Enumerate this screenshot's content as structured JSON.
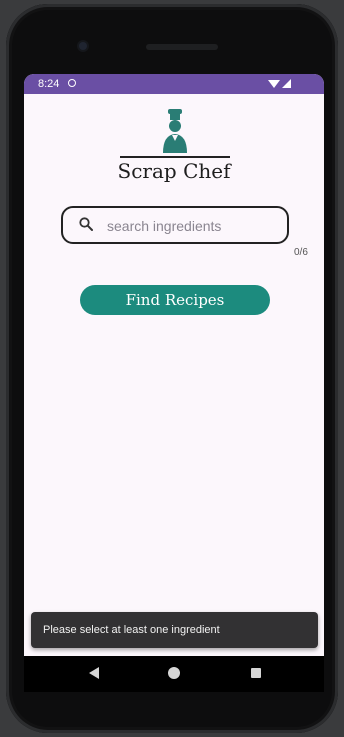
{
  "status_bar": {
    "time": "8:24"
  },
  "app": {
    "title": "Scrap Chef"
  },
  "search": {
    "placeholder": "search ingredients",
    "value": "",
    "counter": "0/6"
  },
  "actions": {
    "find_label": "Find Recipes"
  },
  "snackbar": {
    "message": "Please select at least one ingredient"
  },
  "colors": {
    "status_bar": "#6a4fa4",
    "accent": "#1c8b7e",
    "background": "#fcf7fc",
    "snackbar": "#323133"
  },
  "icons": [
    "chef-icon",
    "search-icon",
    "back-icon",
    "home-icon",
    "recents-icon"
  ]
}
